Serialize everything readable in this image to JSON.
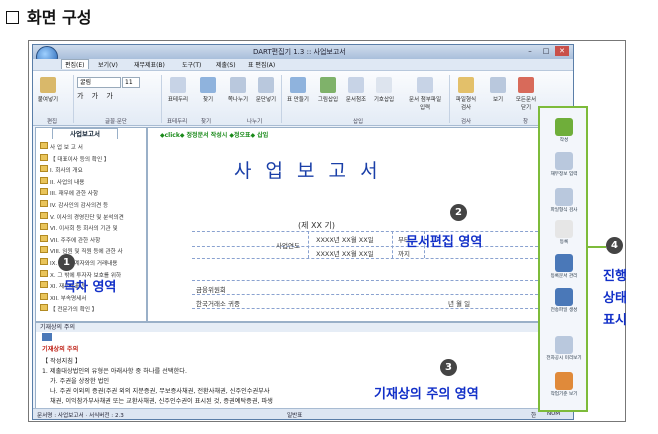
{
  "heading": "화면 구성",
  "window": {
    "title": "DART편집기 1.3 :: 사업보고서",
    "menus": [
      "편집(E)",
      "보기(V)",
      "재무제표(B)",
      "도구(T)",
      "제출(S)",
      "표 편집(A)"
    ],
    "ribbon_groups": [
      "편집",
      "글꼴·문단",
      "표테두리",
      "찾기",
      "나누기",
      "삽입",
      "검사",
      "창"
    ],
    "ribbon_buttons": [
      "붙여넣기",
      "표테두리",
      "찾기",
      "쪽나누기",
      "문단넣기",
      "표 만들기",
      "그림삽입",
      "문서첨조",
      "기호삽입",
      "문서 첨부파일 입력",
      "파일형식 검사",
      "보기",
      "모든문서 닫기"
    ],
    "font_name": "굴림",
    "font_size": "11"
  },
  "toc": {
    "tab_label": "사업보고서",
    "items": [
      "사 업 보 고 서",
      "【 대표이사 등의 확인 】",
      "I. 회사의 개요",
      "II. 사업의 내용",
      "III. 재무에 관한 사항",
      "IV. 감사인의 감사의견 등",
      "V. 이사의 경영진단 및 분석의견",
      "VI. 이사회 등 회사의 기관 및",
      "VII. 주주에 관한 사항",
      "VIII. 임원 및 직원 등에 관한 사",
      "IX. 이해관계자와의 거래내용",
      "X. 그 밖에 투자자 보호를 위하",
      "XI. 재무제표 등",
      "XII. 부속명세서",
      "【 전문가의 확인 】"
    ]
  },
  "document": {
    "toolbar_hint": "◆click◆ 정정문서 작성시 ◆정오표◆ 삽입",
    "title": "사 업 보 고 서",
    "term": "(제 XX 기)",
    "period_label": "사업연도",
    "period_from": "XXXX년 XX월 XX일",
    "period_to": "XXXX년 XX월 XX일",
    "from_suffix": "부터",
    "to_suffix": "까지",
    "addressee1": "금융위원회",
    "addressee2": "한국거래소 귀중",
    "date_line": "년      월      일"
  },
  "notes": {
    "header": "기재상의 주의",
    "title": "기재상의 주의",
    "lines": [
      "【 작성지침 】",
      "1. 제출대상법인의 유형은 아래사항 중 하나를 선택한다.",
      "가. 주권을 상장한 법인",
      "나. 주권 이외의 증권(주권 외의 지분증권, 무보증사채권, 전환사채권, 신주인수권부사",
      "채권, 이익참가부사채권 또는 교환사채권, 신주인수권이 표시된 것, 증권예탁증권, 파생"
    ]
  },
  "status": {
    "left": "문서명 : 사업보고서  · 서식버전 : 2.3",
    "mid": "일반표",
    "right1": "한",
    "right2": "NUM"
  },
  "progress_panel": {
    "items": [
      "작성",
      "재무정보 입력",
      "파일형식 검사",
      "등록",
      "등록문서 관리",
      "전송파일 생성",
      "전자공시 미리보기",
      "작업기준 보기"
    ]
  },
  "callouts": [
    {
      "num": "1",
      "text": "목차 영역"
    },
    {
      "num": "2",
      "text": "문서편집 영역"
    },
    {
      "num": "3",
      "text": "기재상의 주의 영역"
    },
    {
      "num": "4",
      "text": "진행 상태 표시"
    }
  ],
  "colors": {
    "accent": "#1230c8",
    "panel_border": "#7dbb3a",
    "title_blue": "#1a3fa8"
  }
}
